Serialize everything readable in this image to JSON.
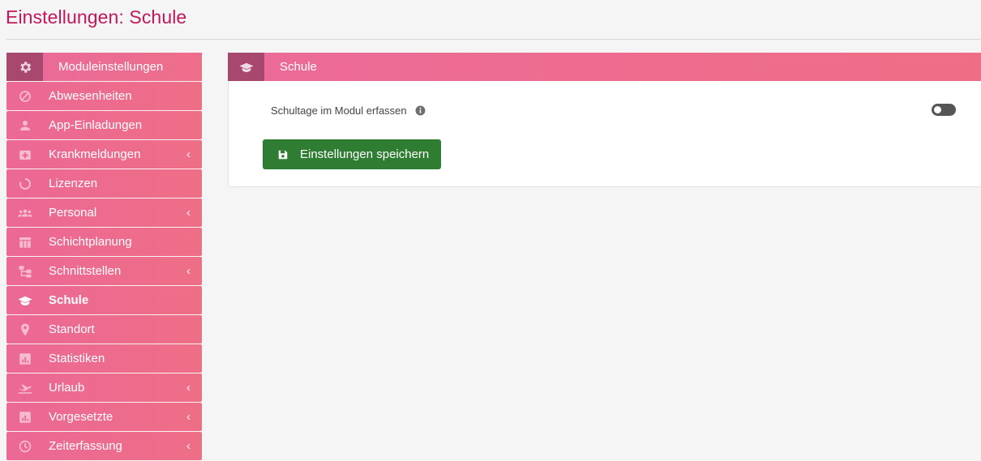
{
  "page": {
    "title": "Einstellungen: Schule"
  },
  "sidebar": {
    "header": {
      "label": "Moduleinstellungen",
      "icon": "gear-icon"
    },
    "items": [
      {
        "label": "Abwesenheiten",
        "icon": "ban-icon",
        "chevron": ""
      },
      {
        "label": "App-Einladungen",
        "icon": "user-icon",
        "chevron": ""
      },
      {
        "label": "Krankmeldungen",
        "icon": "medical-kit-icon",
        "chevron": "‹"
      },
      {
        "label": "Lizenzen",
        "icon": "circle-notch-icon",
        "chevron": ""
      },
      {
        "label": "Personal",
        "icon": "users-icon",
        "chevron": "‹"
      },
      {
        "label": "Schichtplanung",
        "icon": "calendar-table-icon",
        "chevron": ""
      },
      {
        "label": "Schnittstellen",
        "icon": "sitemap-icon",
        "chevron": "‹"
      },
      {
        "label": "Schule",
        "icon": "graduation-cap-icon",
        "chevron": ""
      },
      {
        "label": "Standort",
        "icon": "map-marker-icon",
        "chevron": ""
      },
      {
        "label": "Statistiken",
        "icon": "chart-icon",
        "chevron": ""
      },
      {
        "label": "Urlaub",
        "icon": "plane-departure-icon",
        "chevron": "‹"
      },
      {
        "label": "Vorgesetzte",
        "icon": "chart-icon",
        "chevron": "‹"
      },
      {
        "label": "Zeiterfassung",
        "icon": "clock-icon",
        "chevron": "‹"
      }
    ]
  },
  "panel": {
    "title": "Schule",
    "icon": "graduation-cap-icon",
    "setting_label": "Schultage im Modul erfassen",
    "toggle_on": false,
    "save_label": "Einstellungen speichern"
  },
  "colors": {
    "accent": "#c2185b",
    "header_pink": "#ec6a98",
    "icon_box": "#a8486e",
    "save_green": "#2e7d32"
  }
}
